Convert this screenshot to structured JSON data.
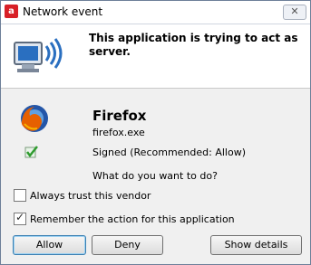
{
  "window": {
    "title": "Network event",
    "close_label": "✕"
  },
  "header": {
    "message": "This application is trying to act as server."
  },
  "app": {
    "name": "Firefox",
    "executable": "firefox.exe",
    "signature": "Signed (Recommended: Allow)",
    "question": "What do you want to do?"
  },
  "options": {
    "trust_vendor": {
      "label": "Always trust this vendor",
      "checked": false
    },
    "remember_action": {
      "label": "Remember the action for this application",
      "checked": true
    }
  },
  "buttons": {
    "allow": "Allow",
    "deny": "Deny",
    "details": "Show details"
  },
  "icons": {
    "title_logo": "avira-logo-icon",
    "banner": "network-monitor-icon",
    "app": "firefox-icon",
    "signed": "signed-check-icon"
  },
  "colors": {
    "brand_red": "#d81f26",
    "accent_blue": "#3c7fb1",
    "signed_green": "#2e9b2e"
  }
}
